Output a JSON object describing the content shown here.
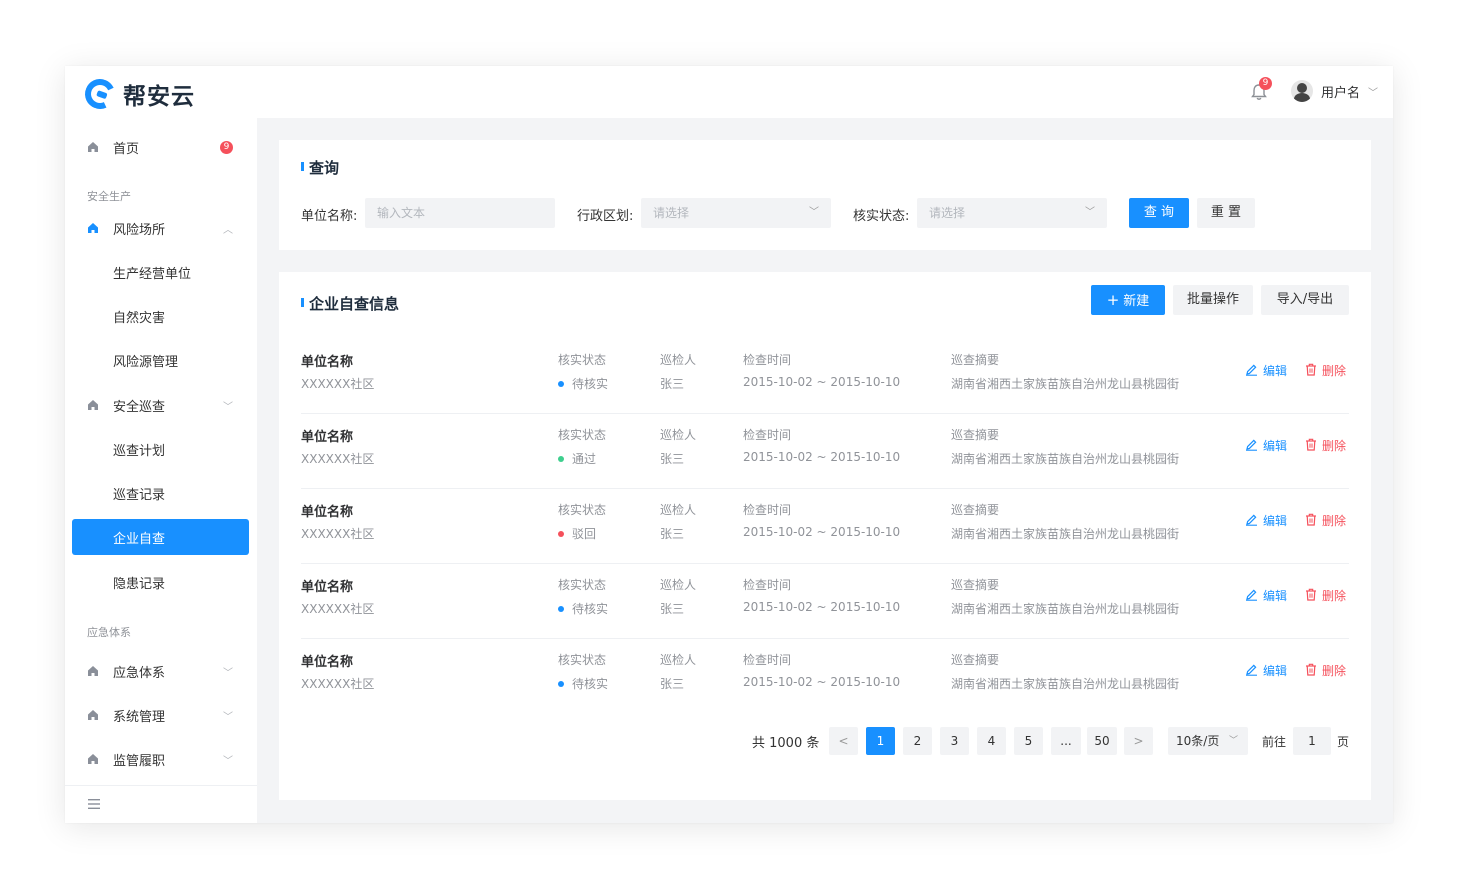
{
  "header": {
    "brand": "帮安云",
    "notification_count": "9",
    "user_name": "用户名",
    "brand_color": "#1890ff"
  },
  "sidebar": {
    "home": {
      "label": "首页",
      "badge": "9"
    },
    "group_safety": "安全生产",
    "risk_sites": {
      "label": "风险场所",
      "children": [
        "生产经营单位",
        "自然灾害",
        "风险源管理"
      ]
    },
    "patrol": {
      "label": "安全巡查",
      "children": [
        "巡查计划",
        "巡查记录",
        "企业自查",
        "隐患记录"
      ]
    },
    "active_item": "企业自查",
    "group_emergency": "应急体系",
    "emergency": {
      "label": "应急体系"
    },
    "system": {
      "label": "系统管理"
    },
    "supervision": {
      "label": "监管履职"
    }
  },
  "query": {
    "title": "查询",
    "unit_label": "单位名称:",
    "unit_placeholder": "输入文本",
    "region_label": "行政区划:",
    "region_placeholder": "请选择",
    "status_label": "核实状态:",
    "status_placeholder": "请选择",
    "search_btn": "查 询",
    "reset_btn": "重 置"
  },
  "list": {
    "title": "企业自查信息",
    "new_btn": "新建",
    "batch_btn": "批量操作",
    "io_btn": "导入/导出",
    "headers": {
      "unit": "单位名称",
      "status": "核实状态",
      "inspector": "巡检人",
      "time": "检查时间",
      "summary": "巡查摘要"
    },
    "edit_label": "编辑",
    "delete_label": "删除",
    "rows": [
      {
        "unit": "XXXXXX社区",
        "status": "待核实",
        "status_color": "#1890ff",
        "inspector": "张三",
        "time": "2015-10-02 ~ 2015-10-10",
        "summary": "湖南省湘西土家族苗族自治州龙山县桃园街"
      },
      {
        "unit": "XXXXXX社区",
        "status": "通过",
        "status_color": "#3ecf8e",
        "inspector": "张三",
        "time": "2015-10-02 ~ 2015-10-10",
        "summary": "湖南省湘西土家族苗族自治州龙山县桃园街"
      },
      {
        "unit": "XXXXXX社区",
        "status": "驳回",
        "status_color": "#f5505b",
        "inspector": "张三",
        "time": "2015-10-02 ~ 2015-10-10",
        "summary": "湖南省湘西土家族苗族自治州龙山县桃园街"
      },
      {
        "unit": "XXXXXX社区",
        "status": "待核实",
        "status_color": "#1890ff",
        "inspector": "张三",
        "time": "2015-10-02 ~ 2015-10-10",
        "summary": "湖南省湘西土家族苗族自治州龙山县桃园街"
      },
      {
        "unit": "XXXXXX社区",
        "status": "待核实",
        "status_color": "#1890ff",
        "inspector": "张三",
        "time": "2015-10-02 ~ 2015-10-10",
        "summary": "湖南省湘西土家族苗族自治州龙山县桃园街"
      }
    ]
  },
  "pagination": {
    "total": "共 1000 条",
    "prev": "<",
    "next": ">",
    "pages": [
      "1",
      "2",
      "3",
      "4",
      "5",
      "...",
      "50"
    ],
    "current": "1",
    "page_size": "10条/页",
    "goto_prefix": "前往",
    "goto_value": "1",
    "goto_suffix": "页"
  }
}
